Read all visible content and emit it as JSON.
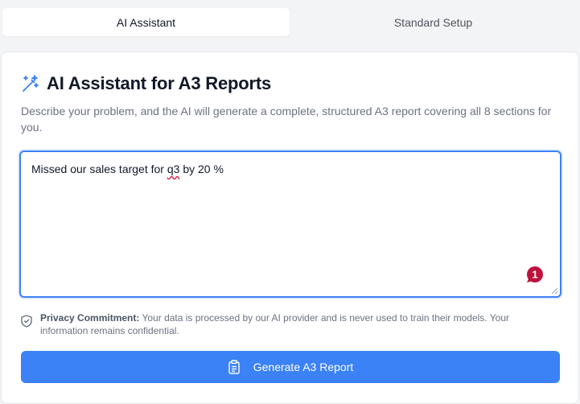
{
  "tabs": [
    {
      "label": "AI Assistant",
      "active": true
    },
    {
      "label": "Standard Setup",
      "active": false
    }
  ],
  "panel": {
    "title": "AI Assistant for A3 Reports",
    "title_icon": "magic-wand-icon",
    "description": "Describe your problem, and the AI will generate a complete, structured A3 report covering all 8 sections for you.",
    "problem_input": {
      "value_before": "Missed our sales target for ",
      "value_misspelled": "q3",
      "value_after": " by 20 %"
    },
    "notification_badge": "1",
    "privacy": {
      "icon": "shield-check-icon",
      "label": "Privacy Commitment:",
      "text": " Your data is processed by our AI provider and is never used to train their models. Your information remains confidential."
    },
    "generate_button": {
      "label": "Generate A3 Report",
      "icon": "clipboard-icon"
    }
  },
  "colors": {
    "accent": "#3b82f6",
    "badge": "#be123c",
    "page_bg": "#f3f4f6"
  }
}
